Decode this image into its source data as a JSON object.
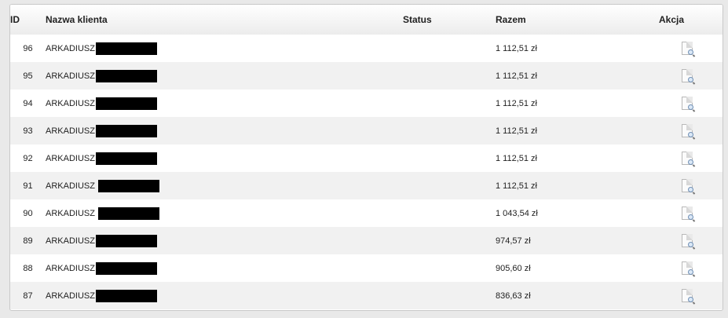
{
  "table": {
    "headers": {
      "id": "ID",
      "name": "Nazwa klienta",
      "status": "Status",
      "total": "Razem",
      "action": "Akcja"
    },
    "rows": [
      {
        "id": "96",
        "name": "ARKADIUSZ",
        "status": "",
        "total": "1 112,51 zł",
        "action_icon": "view-document-icon"
      },
      {
        "id": "95",
        "name": "ARKADIUSZ",
        "status": "",
        "total": "1 112,51 zł",
        "action_icon": "view-document-icon"
      },
      {
        "id": "94",
        "name": "ARKADIUSZ",
        "status": "",
        "total": "1 112,51 zł",
        "action_icon": "view-document-icon"
      },
      {
        "id": "93",
        "name": "ARKADIUSZ",
        "status": "",
        "total": "1 112,51 zł",
        "action_icon": "view-document-icon"
      },
      {
        "id": "92",
        "name": "ARKADIUSZ",
        "status": "",
        "total": "1 112,51 zł",
        "action_icon": "view-document-icon"
      },
      {
        "id": "91",
        "name": "ARKADIUSZ",
        "status": "",
        "total": "1 112,51 zł",
        "action_icon": "view-document-icon"
      },
      {
        "id": "90",
        "name": "ARKADIUSZ",
        "status": "",
        "total": "1 043,54 zł",
        "action_icon": "view-document-icon"
      },
      {
        "id": "89",
        "name": "ARKADIUSZ",
        "status": "",
        "total": "974,57 zł",
        "action_icon": "view-document-icon"
      },
      {
        "id": "88",
        "name": "ARKADIUSZ",
        "status": "",
        "total": "905,60 zł",
        "action_icon": "view-document-icon"
      },
      {
        "id": "87",
        "name": "ARKADIUSZ",
        "status": "",
        "total": "836,63 zł",
        "action_icon": "view-document-icon"
      }
    ]
  },
  "colors": {
    "row_alt": "#f1f1f1",
    "row": "#ffffff",
    "background": "#e9e9e9",
    "redaction": "#000000"
  }
}
